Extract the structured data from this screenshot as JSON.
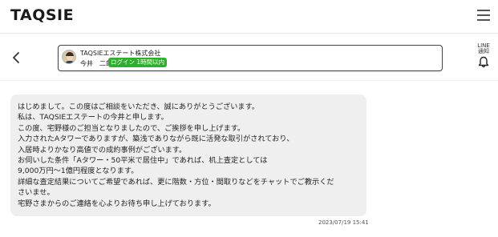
{
  "header": {
    "logo_text": "TAQSIE",
    "menu_icon": "hamburger-menu-icon"
  },
  "chat_header": {
    "back_icon": "chevron-left-icon",
    "company_name": "TAQSIEエステート株式会社",
    "agent_name": "今井　二郎",
    "login_status": "ログイン 1時間以内",
    "login_status_color": "#2eae2e",
    "notification_label_1": "LINE",
    "notification_label_2": "通知",
    "bell_icon": "bell-icon"
  },
  "message": {
    "lines": [
      "はじめまして。この度はご相談をいただき、誠にありがとうございます。",
      "私は、TAQSIEエステートの今井と申します。",
      "この度、宅野様のご担当となりましたので、ご挨拶を申し上げます。",
      "入力されたAタワーでありますが、築浅でありながら既に活発な取引がされており、",
      "入居時よりかなり高値での成約事例がございます。",
      "お伺いした条件「Aタワー・50平米で居住中」であれば、机上査定としては",
      "9,000万円〜1億円程度となります。",
      "詳細な査定結果についてご希望であれば、更に階数・方位・間取りなどをチャットでご教示くだ",
      "さいませ。",
      "宅野さまからのご連絡を心よりお待ち申し上げております。"
    ],
    "timestamp": "2023/07/19 15:41",
    "bubble_color": "#efefef"
  }
}
